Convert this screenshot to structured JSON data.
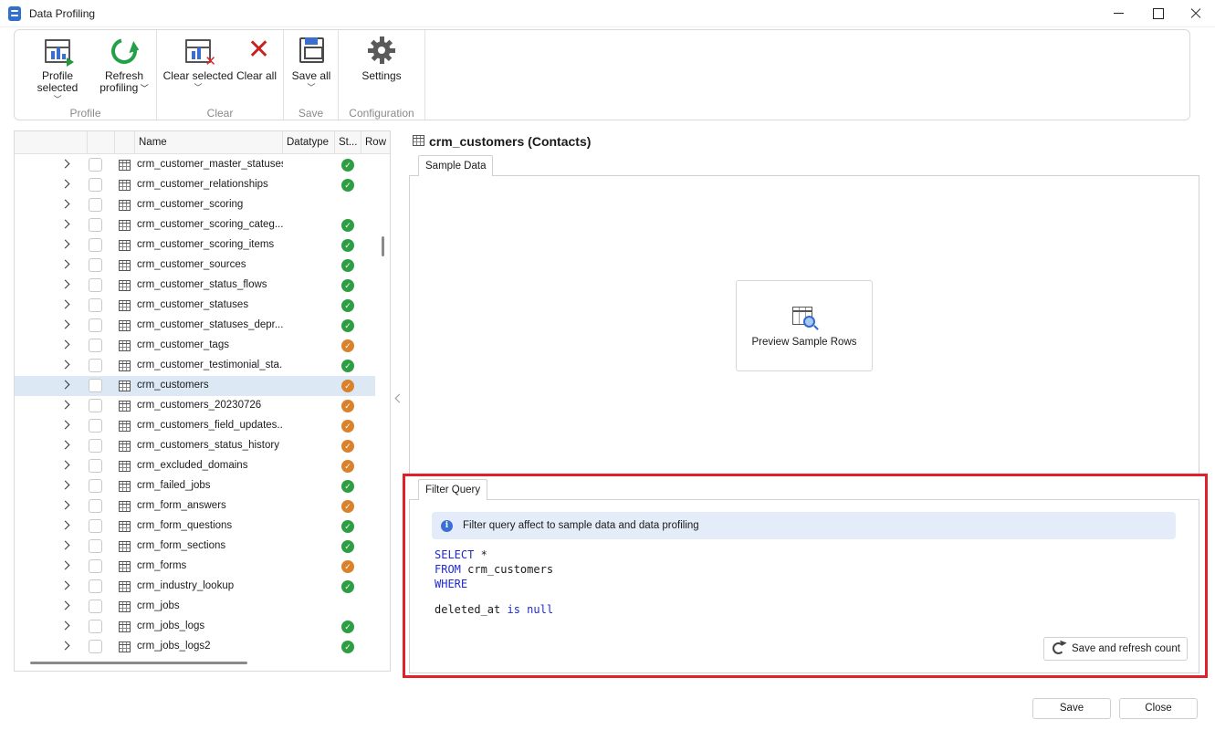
{
  "window": {
    "title": "Data Profiling"
  },
  "ribbon": {
    "groups": [
      {
        "caption": "Profile",
        "buttons": [
          {
            "label": "Profile selected"
          },
          {
            "label": "Refresh profiling"
          }
        ]
      },
      {
        "caption": "Clear",
        "buttons": [
          {
            "label": "Clear selected"
          },
          {
            "label": "Clear all"
          }
        ]
      },
      {
        "caption": "Save",
        "buttons": [
          {
            "label": "Save all"
          }
        ]
      },
      {
        "caption": "Configuration",
        "buttons": [
          {
            "label": "Settings"
          }
        ]
      }
    ],
    "refresh_line1": "Refresh",
    "refresh_line2": "profiling"
  },
  "tree": {
    "columns": [
      "Name",
      "Datatype",
      "St...",
      "Row D"
    ],
    "rows": [
      {
        "name": "crm_customer_master_statuses",
        "status": "ok"
      },
      {
        "name": "crm_customer_relationships",
        "status": "ok"
      },
      {
        "name": "crm_customer_scoring",
        "status": ""
      },
      {
        "name": "crm_customer_scoring_categ...",
        "status": "ok"
      },
      {
        "name": "crm_customer_scoring_items",
        "status": "ok"
      },
      {
        "name": "crm_customer_sources",
        "status": "ok"
      },
      {
        "name": "crm_customer_status_flows",
        "status": "ok"
      },
      {
        "name": "crm_customer_statuses",
        "status": "ok"
      },
      {
        "name": "crm_customer_statuses_depr...",
        "status": "ok"
      },
      {
        "name": "crm_customer_tags",
        "status": "warn"
      },
      {
        "name": "crm_customer_testimonial_sta...",
        "status": "ok"
      },
      {
        "name": "crm_customers",
        "status": "warn",
        "selected": true
      },
      {
        "name": "crm_customers_20230726",
        "status": "warn"
      },
      {
        "name": "crm_customers_field_updates...",
        "status": "warn"
      },
      {
        "name": "crm_customers_status_history",
        "status": "warn"
      },
      {
        "name": "crm_excluded_domains",
        "status": "warn"
      },
      {
        "name": "crm_failed_jobs",
        "status": "ok"
      },
      {
        "name": "crm_form_answers",
        "status": "warn"
      },
      {
        "name": "crm_form_questions",
        "status": "ok"
      },
      {
        "name": "crm_form_sections",
        "status": "ok"
      },
      {
        "name": "crm_forms",
        "status": "warn"
      },
      {
        "name": "crm_industry_lookup",
        "status": "ok"
      },
      {
        "name": "crm_jobs",
        "status": ""
      },
      {
        "name": "crm_jobs_logs",
        "status": "ok"
      },
      {
        "name": "crm_jobs_logs2",
        "status": "ok"
      }
    ]
  },
  "detail": {
    "title": "crm_customers (Contacts)",
    "sample_tab": "Sample Data",
    "preview_button": "Preview Sample Rows",
    "filter_tab": "Filter Query",
    "info_text": "Filter query affect to sample data and data profiling",
    "sql": {
      "select_kw": "SELECT",
      "select_rest": " *",
      "from_kw": "FROM",
      "from_rest": " crm_customers",
      "where_kw": "WHERE",
      "cond_col": "deleted_at ",
      "cond_kw": "is null"
    },
    "save_refresh_button": "Save and refresh count"
  },
  "footer": {
    "save": "Save",
    "close": "Close"
  },
  "colors": {
    "accent": "#2f6fce",
    "ok": "#2e9e44",
    "warn": "#d9822b",
    "highlight": "#e0202b",
    "selection": "#dde8f5"
  }
}
